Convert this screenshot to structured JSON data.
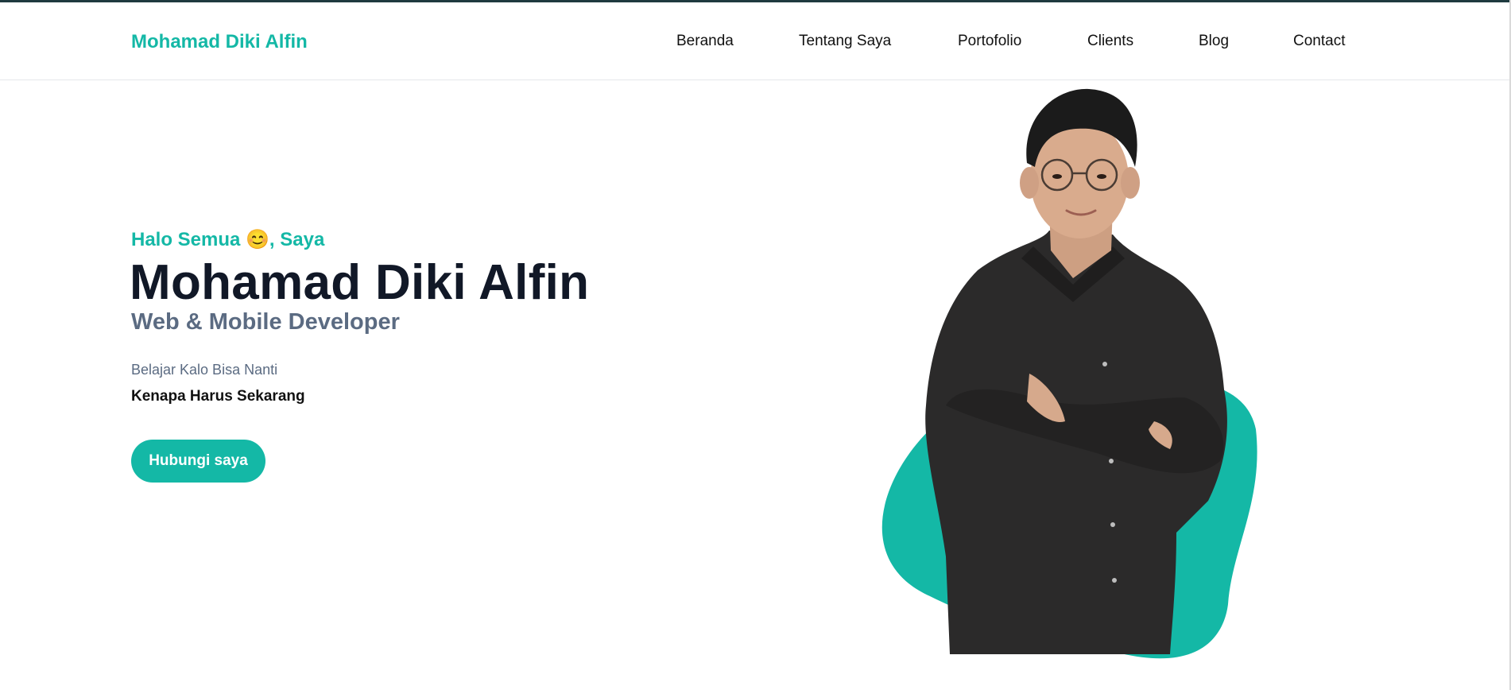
{
  "header": {
    "brand": "Mohamad Diki Alfin",
    "nav": [
      "Beranda",
      "Tentang Saya",
      "Portofolio",
      "Clients",
      "Blog",
      "Contact"
    ]
  },
  "hero": {
    "greeting": "Halo Semua 😊, Saya",
    "name": "Mohamad Diki Alfin",
    "role": "Web & Mobile Developer",
    "tagline": "Belajar Kalo Bisa Nanti",
    "tagline_bold": "Kenapa Harus Sekarang",
    "cta_label": "Hubungi saya",
    "photo_icon": "portrait-photo"
  },
  "colors": {
    "accent": "#14b8a6",
    "heading": "#111827",
    "muted": "#5b6b82"
  }
}
